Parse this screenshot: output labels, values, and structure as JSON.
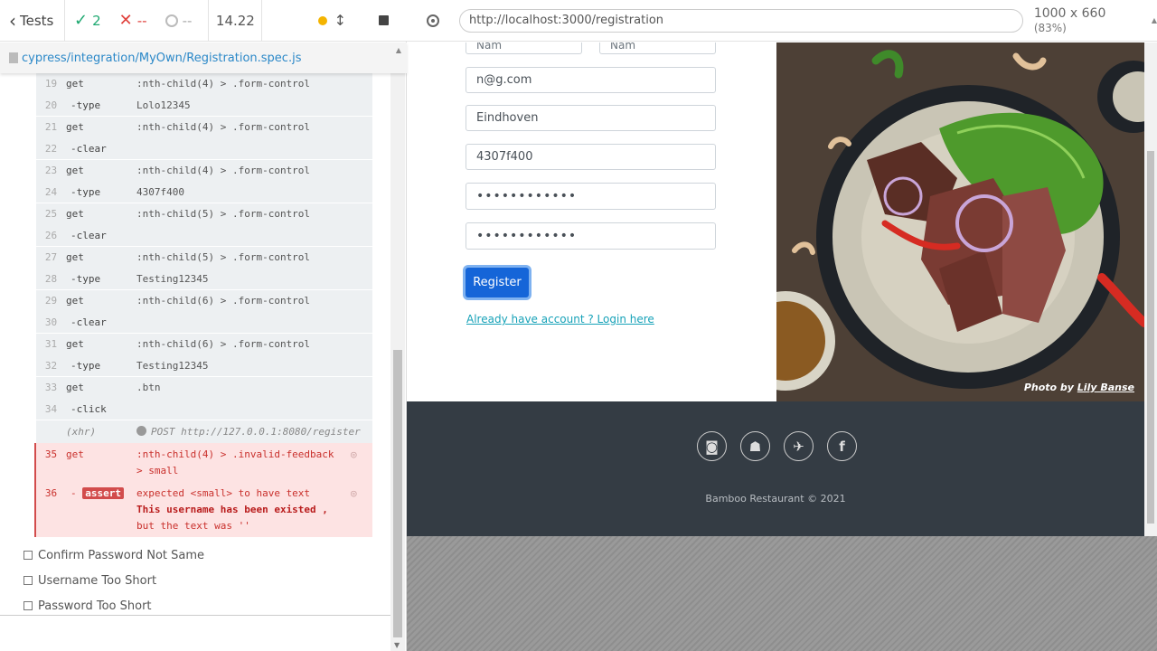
{
  "runner": {
    "tests_label": "Tests",
    "passed": "2",
    "failed": "--",
    "pending": "--",
    "duration": "14.22",
    "spec_path": "cypress/integration/MyOwn/Registration.spec.js"
  },
  "commands": [
    {
      "n1": "19",
      "c1": "get",
      "a1": ":nth-child(4) > .form-control",
      "n2": "20",
      "c2": "-type",
      "a2": "Lolo12345"
    },
    {
      "n1": "21",
      "c1": "get",
      "a1": ":nth-child(4) > .form-control",
      "n2": "22",
      "c2": "-clear",
      "a2": ""
    },
    {
      "n1": "23",
      "c1": "get",
      "a1": ":nth-child(4) > .form-control",
      "n2": "24",
      "c2": "-type",
      "a2": "4307f400"
    },
    {
      "n1": "25",
      "c1": "get",
      "a1": ":nth-child(5) > .form-control",
      "n2": "26",
      "c2": "-clear",
      "a2": ""
    },
    {
      "n1": "27",
      "c1": "get",
      "a1": ":nth-child(5) > .form-control",
      "n2": "28",
      "c2": "-type",
      "a2": "Testing12345"
    },
    {
      "n1": "29",
      "c1": "get",
      "a1": ":nth-child(6) > .form-control",
      "n2": "30",
      "c2": "-clear",
      "a2": ""
    },
    {
      "n1": "31",
      "c1": "get",
      "a1": ":nth-child(6) > .form-control",
      "n2": "32",
      "c2": "-type",
      "a2": "Testing12345"
    },
    {
      "n1": "33",
      "c1": "get",
      "a1": ".btn",
      "n2": "34",
      "c2": "-click",
      "a2": ""
    }
  ],
  "xhr": {
    "label": "(xhr)",
    "text": "POST http://127.0.0.1:8080/register"
  },
  "error_get": {
    "n": "35",
    "c": "get",
    "a1": ":nth-child(4) > .invalid-feedback",
    "a2": "> small"
  },
  "error_assert": {
    "n": "36",
    "dash": "-",
    "badge": "assert",
    "l1": "expected  <small>  to have text",
    "l2": "This username has been existed ,",
    "l3": "but the text was  ''"
  },
  "tests": [
    "Confirm Password Not Same",
    "Username Too Short",
    "Password Too Short"
  ],
  "aut": {
    "url": "http://localhost:3000/registration",
    "viewport": "1000 x 660",
    "scale": "(83%)"
  },
  "form": {
    "first_name": "Nam",
    "last_name": "Nam",
    "email": "n@g.com",
    "city": "Eindhoven",
    "username": "4307f400",
    "password": "••••••••••••",
    "confirm_password": "••••••••••••",
    "register_label": "Register",
    "login_link": "Already have account ? Login here"
  },
  "photo": {
    "credit_prefix": "Photo by ",
    "author": "Lily Banse"
  },
  "footer": {
    "icons": [
      "instagram-icon",
      "snapchat-icon",
      "twitter-icon",
      "facebook-icon"
    ],
    "copyright": "Bamboo Restaurant © 2021"
  }
}
